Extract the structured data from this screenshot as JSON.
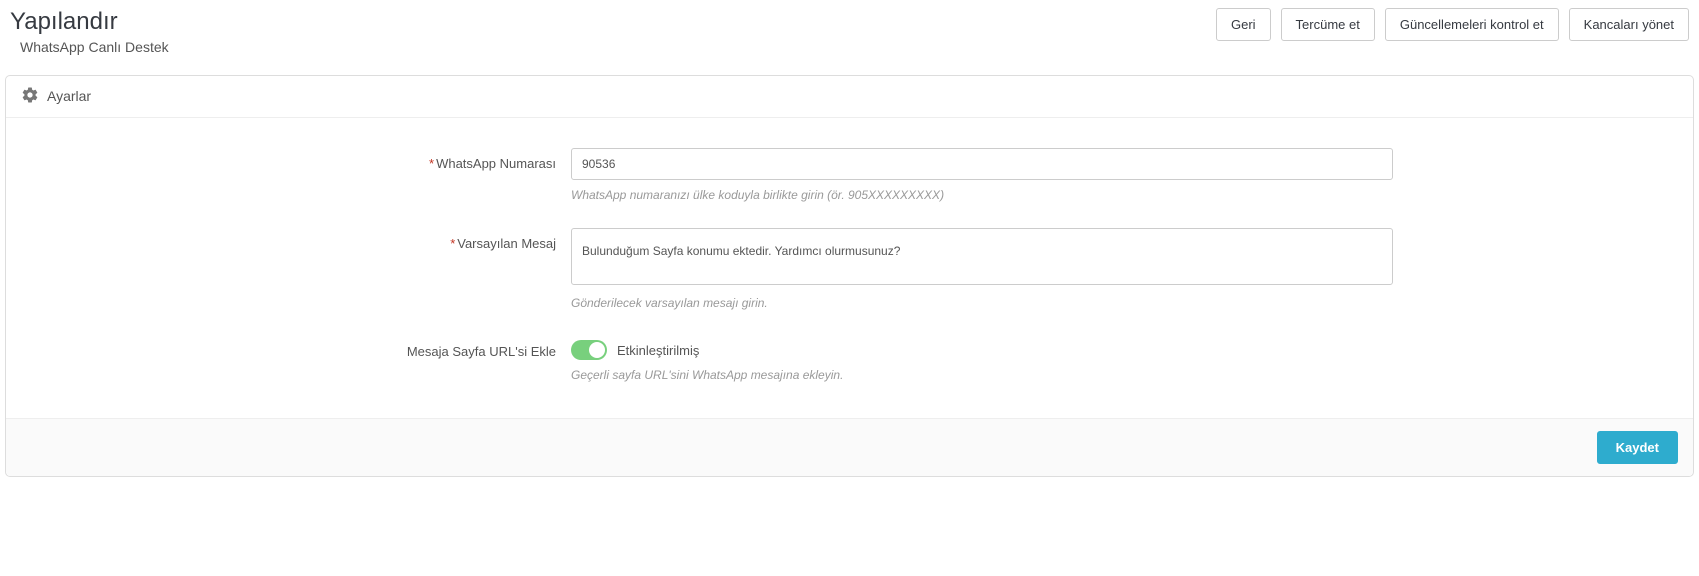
{
  "header": {
    "title": "Yapılandır",
    "subtitle": "WhatsApp Canlı Destek",
    "actions": {
      "back": "Geri",
      "translate": "Tercüme et",
      "check_updates": "Güncellemeleri kontrol et",
      "manage_hooks": "Kancaları yönet"
    }
  },
  "panel": {
    "title": "Ayarlar",
    "fields": {
      "whatsapp_number": {
        "label": "WhatsApp Numarası",
        "value": "90536",
        "help": "WhatsApp numaranızı ülke koduyla birlikte girin (ör. 905XXXXXXXXX)"
      },
      "default_message": {
        "label": "Varsayılan Mesaj",
        "value": "Bulunduğum Sayfa konumu ektedir. Yardımcı olurmusunuz?",
        "help": "Gönderilecek varsayılan mesajı girin."
      },
      "append_url": {
        "label": "Mesaja Sayfa URL'si Ekle",
        "status": "Etkinleştirilmiş",
        "help": "Geçerli sayfa URL'sini WhatsApp mesajına ekleyin."
      }
    },
    "save": "Kaydet"
  }
}
